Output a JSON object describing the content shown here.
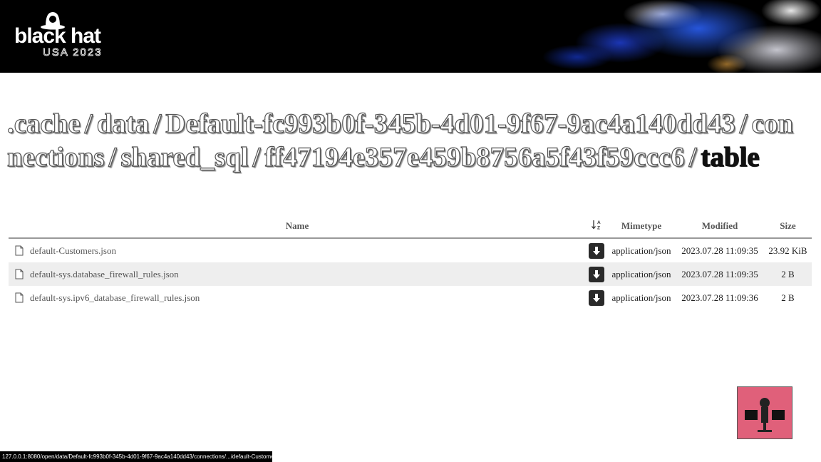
{
  "banner": {
    "logo_main": "black hat",
    "logo_sub": "USA 2023"
  },
  "breadcrumb": [
    ".cache",
    "data",
    "Default-fc993b0f-345b-4d01-9f67-9ac4a140dd43",
    "connections",
    "shared_sql",
    "ff47194e357e459b8756a5f43f59ccc6",
    "table"
  ],
  "breadcrumb_separator": "/",
  "table": {
    "columns": {
      "name": "Name",
      "mimetype": "Mimetype",
      "modified": "Modified",
      "size": "Size"
    },
    "sort_icon": "sort-alpha-icon",
    "rows": [
      {
        "name": "default-Customers.json",
        "mimetype": "application/json",
        "modified": "2023.07.28 11:09:35",
        "size": "23.92 KiB"
      },
      {
        "name": "default-sys.database_firewall_rules.json",
        "mimetype": "application/json",
        "modified": "2023.07.28 11:09:35",
        "size": "2 B"
      },
      {
        "name": "default-sys.ipv6_database_firewall_rules.json",
        "mimetype": "application/json",
        "modified": "2023.07.28 11:09:36",
        "size": "2 B"
      }
    ]
  },
  "status_url": "127.0.0.1:8080/open/data/Default-fc993b0f-345b-4d01-9f67-9ac4a140dd43/connections/.../default-Customers.j...",
  "colors": {
    "banner_bg": "#000000",
    "row_alt": "#eeeeee",
    "download_button": "#2a2a2a",
    "webcam_bg": "#e0607a"
  }
}
